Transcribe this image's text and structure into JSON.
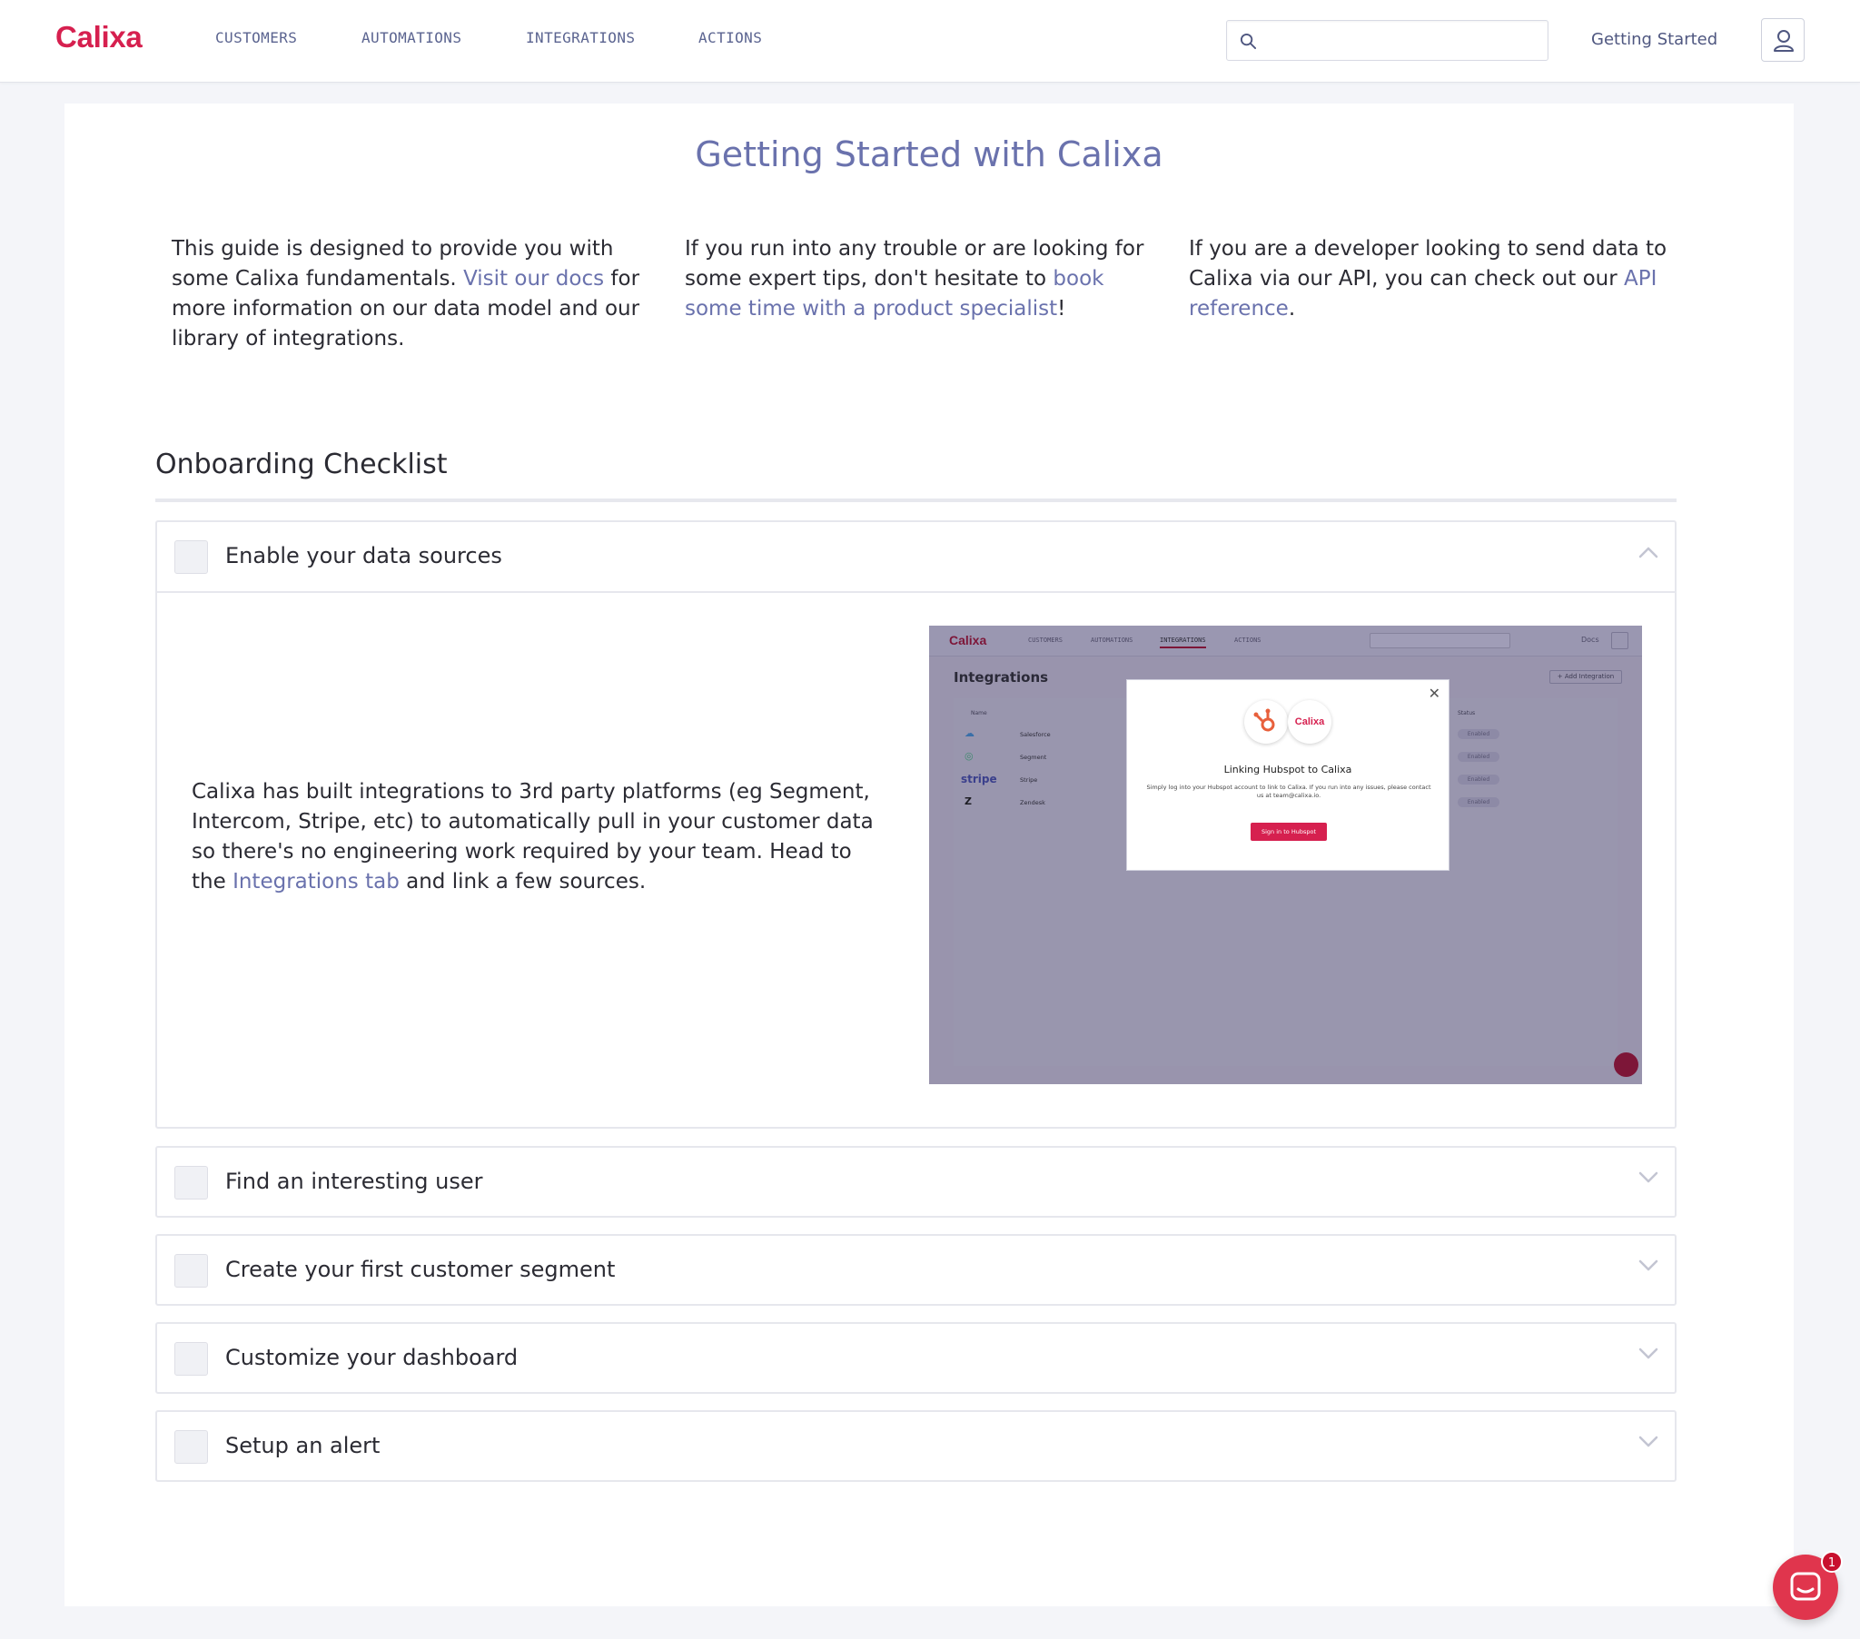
{
  "nav": {
    "logo": "Calixa",
    "links": [
      "CUSTOMERS",
      "AUTOMATIONS",
      "INTEGRATIONS",
      "ACTIONS"
    ],
    "search_placeholder": "",
    "getting_started": "Getting Started"
  },
  "page": {
    "title": "Getting Started with Calixa",
    "intro": [
      {
        "before": "This guide is designed to provide you with some Calixa fundamentals. ",
        "link": "Visit our docs",
        "after": " for more information on our data model and our library of integrations."
      },
      {
        "before": "If you run into any trouble or are looking for some expert tips, don't hesitate to ",
        "link": "book some time with a product specialist",
        "after": "!"
      },
      {
        "before": "If you are a developer looking to send data to Calixa via our API, you can check out our ",
        "link": "API reference",
        "after": "."
      }
    ]
  },
  "checklist": {
    "title": "Onboarding Checklist",
    "items": [
      {
        "label": "Enable your data sources",
        "expanded": true,
        "body_before": "Calixa has built integrations to 3rd party platforms (eg Segment, Intercom, Stripe, etc) to automatically pull in your customer data so there's no engineering work required by your team. Head to the ",
        "body_link": "Integrations tab",
        "body_after": " and link a few sources."
      },
      {
        "label": "Find an interesting user",
        "expanded": false
      },
      {
        "label": "Create your first customer segment",
        "expanded": false
      },
      {
        "label": "Customize your dashboard",
        "expanded": false
      },
      {
        "label": "Setup an alert",
        "expanded": false
      }
    ]
  },
  "preview": {
    "logo": "Calixa",
    "nav": [
      "CUSTOMERS",
      "AUTOMATIONS",
      "INTEGRATIONS",
      "ACTIONS"
    ],
    "docs": "Docs",
    "heading": "Integrations",
    "add_button": "+ Add Integration",
    "col_name": "Name",
    "col_status": "Status",
    "rows": [
      {
        "name": "Salesforce",
        "status": "Enabled"
      },
      {
        "name": "Segment",
        "status": "Enabled"
      },
      {
        "name": "Stripe",
        "status": "Enabled"
      },
      {
        "name": "Zendesk",
        "status": "Enabled"
      }
    ],
    "stripe_logo": "stripe",
    "modal": {
      "brand": "Calixa",
      "title": "Linking Hubspot to Calixa",
      "body": "Simply log into your Hubspot account to link to Calixa. If you run into any issues, please contact us at team@calixa.io.",
      "button": "Sign in to Hubspot"
    }
  },
  "chat": {
    "badge": "1"
  },
  "colors": {
    "brand": "#d6204f",
    "accent": "#6a72ad"
  }
}
